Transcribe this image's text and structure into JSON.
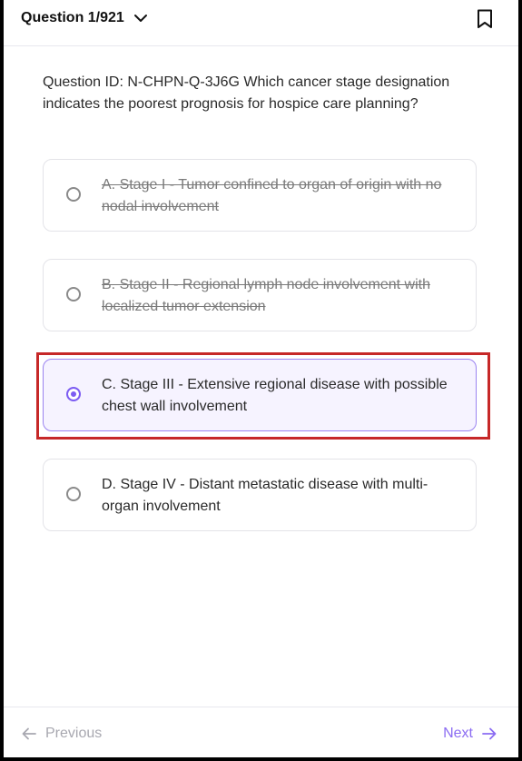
{
  "header": {
    "question_counter": "Question 1/921",
    "dropdown_icon": "chevron-down-icon",
    "bookmark_icon": "bookmark-icon"
  },
  "question": {
    "text": "Question ID: N-CHPN-Q-3J6G Which cancer stage designation indicates the poorest prognosis for hospice care planning?"
  },
  "options": [
    {
      "label": "A. Stage I - Tumor confined to organ of origin with no nodal involvement",
      "state": "struck"
    },
    {
      "label": "B. Stage II - Regional lymph node involvement with localized tumor extension",
      "state": "struck"
    },
    {
      "label": "C. Stage III - Extensive regional disease with possible chest wall involvement",
      "state": "selected"
    },
    {
      "label": "D. Stage IV - Distant metastatic disease with multi-organ involvement",
      "state": "default"
    }
  ],
  "footer": {
    "previous_label": "Previous",
    "next_label": "Next"
  },
  "colors": {
    "accent": "#7c5cf2",
    "highlight_border": "#c62828",
    "selected_bg": "#f6f3ff",
    "disabled_text": "#a8a8b0"
  }
}
